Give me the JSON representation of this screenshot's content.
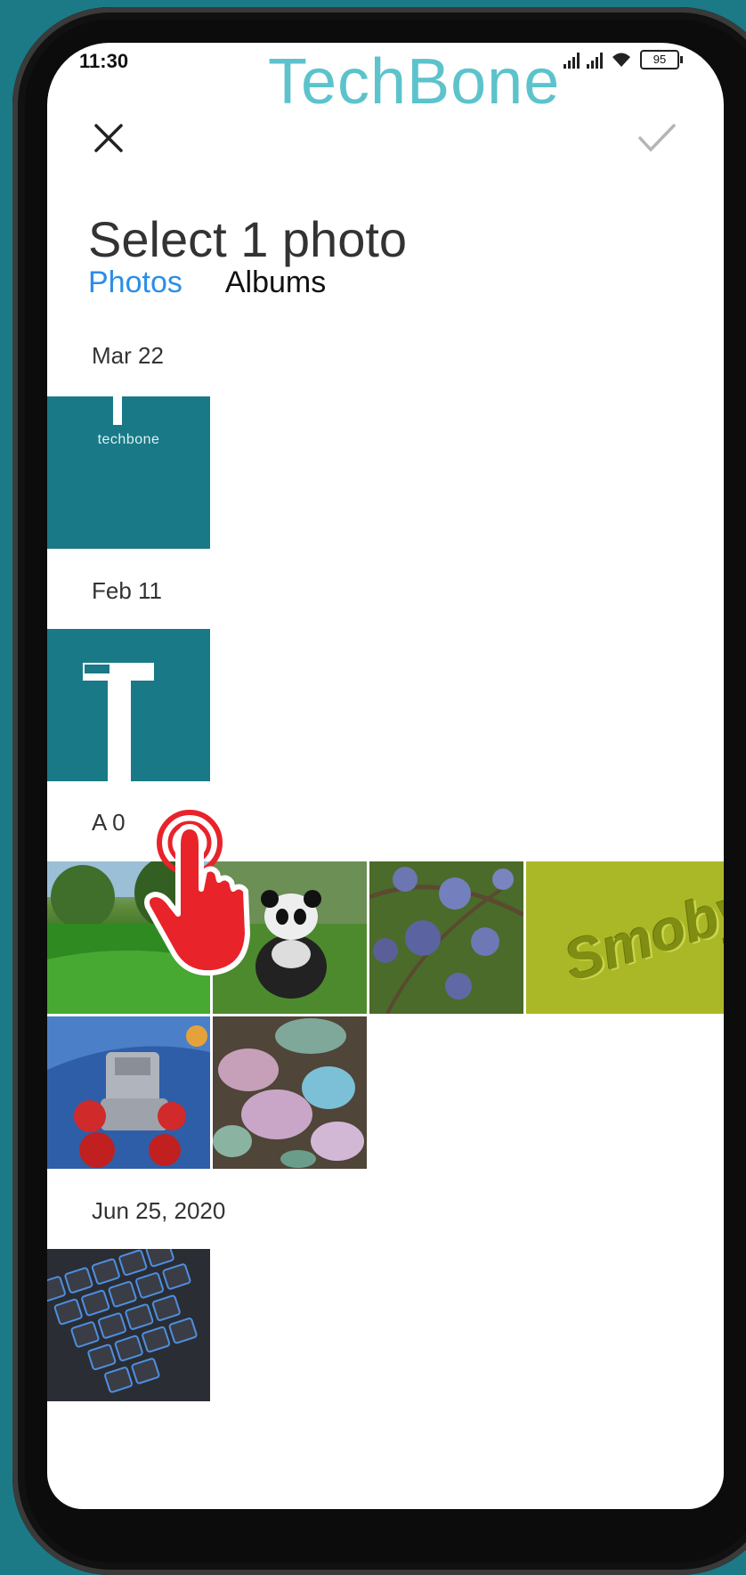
{
  "status_bar": {
    "time": "11:30",
    "battery": "95",
    "watermark": "TechBone",
    "icons": [
      "signal-icon",
      "signal-icon",
      "wifi-icon",
      "battery-icon"
    ]
  },
  "header": {
    "close_icon": "close-icon",
    "confirm_icon": "check-icon",
    "title": "Select 1 photo"
  },
  "tabs": [
    {
      "label": "Photos",
      "active": true
    },
    {
      "label": "Albums",
      "active": false
    }
  ],
  "sections": [
    {
      "date": "Mar 22",
      "photos": [
        {
          "kind": "logo",
          "text": "techbone"
        }
      ]
    },
    {
      "date": "Feb 11",
      "photos": [
        {
          "kind": "logo-t"
        }
      ]
    },
    {
      "date": "A    0",
      "photos": [
        {
          "kind": "grass"
        },
        {
          "kind": "panda"
        },
        {
          "kind": "plums"
        },
        {
          "kind": "smoby",
          "text": "Smoby"
        },
        {
          "kind": "toy-car"
        },
        {
          "kind": "stones"
        }
      ]
    },
    {
      "date": "Jun 25, 2020",
      "photos": [
        {
          "kind": "keyboard"
        }
      ]
    }
  ],
  "colors": {
    "accent": "#2a8ee6",
    "teal": "#197987",
    "tap_red": "#e8232a"
  }
}
